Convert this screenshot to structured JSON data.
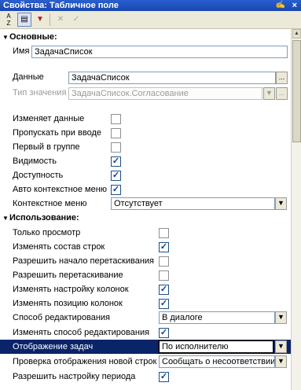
{
  "window": {
    "title": "Свойства: Табличное поле",
    "pin": "ᵖ",
    "close": "×"
  },
  "toolbar": {
    "sort_label": "A↓Z",
    "icons": [
      "sort-az-icon",
      "categories-icon",
      "filter-icon",
      "delete-icon",
      "check-icon"
    ]
  },
  "sections": {
    "basic": "Основные:",
    "usage": "Использование:"
  },
  "basic": {
    "name_label": "Имя",
    "name_value": "ЗадачаСписок",
    "data_label": "Данные",
    "data_value": "ЗадачаСписок",
    "type_label": "Тип значения",
    "type_value": "ЗадачаСписок.Согласование",
    "ellipsis": "..."
  },
  "flags": [
    {
      "label": "Изменяет данные",
      "checked": false
    },
    {
      "label": "Пропускать при вводе",
      "checked": false
    },
    {
      "label": "Первый в группе",
      "checked": false
    },
    {
      "label": "Видимость",
      "checked": true
    },
    {
      "label": "Доступность",
      "checked": true
    },
    {
      "label": "Авто контекстное меню",
      "checked": true
    }
  ],
  "context_menu": {
    "label": "Контекстное меню",
    "value": "Отсутствует"
  },
  "usage": [
    {
      "label": "Только просмотр",
      "checked": false
    },
    {
      "label": "Изменять состав строк",
      "checked": true
    },
    {
      "label": "Разрешить начало перетаскивания",
      "checked": false
    },
    {
      "label": "Разрешить перетаскивание",
      "checked": false
    },
    {
      "label": "Изменять настройку колонок",
      "checked": true
    },
    {
      "label": "Изменять позицию колонок",
      "checked": true
    }
  ],
  "edit_mode": {
    "label": "Способ редактирования",
    "value": "В диалоге"
  },
  "change_edit_mode": {
    "label": "Изменять способ редактирования",
    "checked": true
  },
  "task_display": {
    "label": "Отображение задач",
    "value": "По исполнителю"
  },
  "new_rows_check": {
    "label": "Проверка отображения новой строк",
    "value": "Сообщать о несоответствии"
  },
  "period_setting": {
    "label": "Разрешить настройку периода",
    "checked": true
  },
  "check_mark": "✓"
}
